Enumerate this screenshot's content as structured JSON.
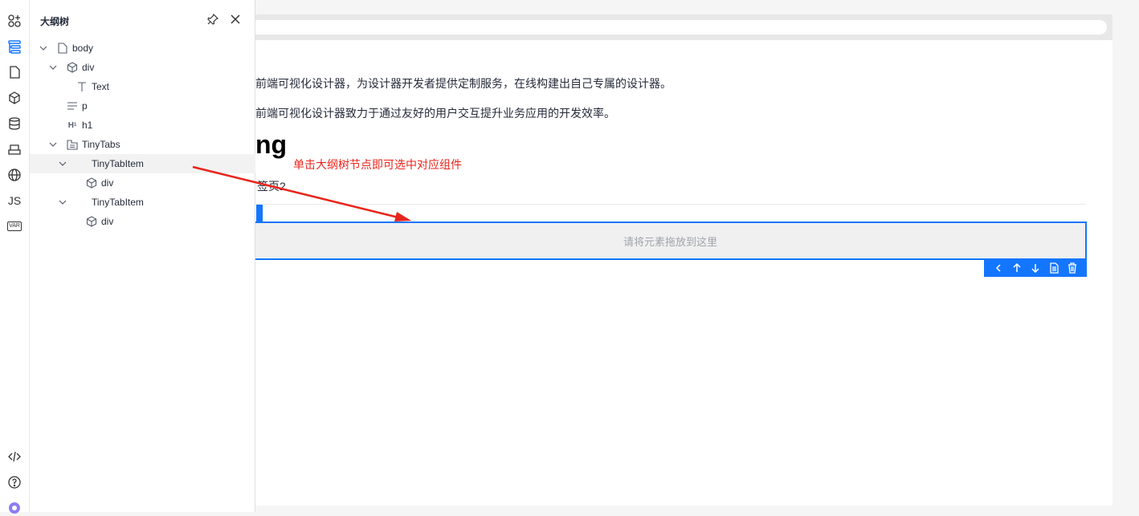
{
  "activity_bar": {
    "items": [
      {
        "icon": "components-icon"
      },
      {
        "icon": "outline-tree-icon",
        "active": true
      },
      {
        "icon": "page-icon"
      },
      {
        "icon": "block-icon"
      },
      {
        "icon": "datasource-icon"
      },
      {
        "icon": "materials-icon"
      },
      {
        "icon": "globe-icon"
      },
      {
        "label": "JS"
      },
      {
        "label": "VAR"
      }
    ],
    "bottom": [
      {
        "icon": "code-icon"
      },
      {
        "icon": "help-icon"
      },
      {
        "icon": "ai-icon"
      }
    ],
    "accent": "#1476ff"
  },
  "panel": {
    "title": "大纲树",
    "pin_icon": "pin-icon",
    "close_icon": "close-icon"
  },
  "tree": [
    {
      "label": "body",
      "icon": "page-icon",
      "expanded": true
    },
    {
      "label": "div",
      "icon": "block-icon",
      "expanded": true
    },
    {
      "label": "Text",
      "icon": "text-icon"
    },
    {
      "label": "p",
      "icon": "paragraph-icon"
    },
    {
      "label": "h1",
      "icon": "heading-icon"
    },
    {
      "label": "TinyTabs",
      "icon": "tabs-icon",
      "expanded": true
    },
    {
      "label": "TinyTabItem",
      "expanded": true,
      "selected": true
    },
    {
      "label": "div",
      "icon": "block-icon"
    },
    {
      "label": "TinyTabItem",
      "expanded": true
    },
    {
      "label": "div",
      "icon": "block-icon"
    }
  ],
  "canvas": {
    "para1": "前端可视化设计器，为设计器开发者提供定制服务，在线构建出自己专属的设计器。",
    "para2": "前端可视化设计器致力于通过友好的用户交互提升业务应用的开发效率。",
    "heading": "ng",
    "tab_label": "签页2",
    "dropzone_text": "请将元素拖放到这里",
    "toolbar": [
      "chevron-left-icon",
      "arrow-up-icon",
      "arrow-down-icon",
      "copy-icon",
      "delete-icon"
    ]
  },
  "annotation": {
    "text": "单击大纲树节点即可选中对应组件",
    "color": "#e8251c"
  }
}
